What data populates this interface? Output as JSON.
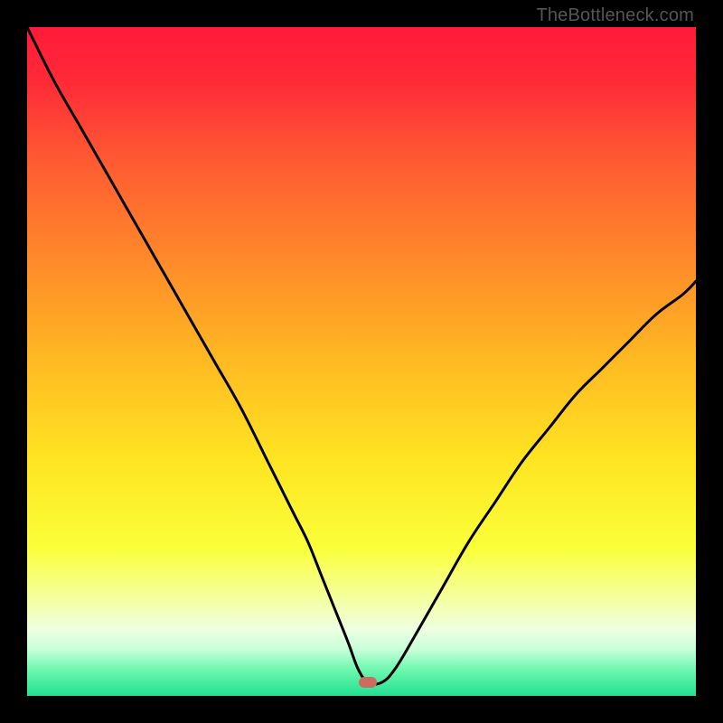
{
  "watermark": "TheBottleneck.com",
  "colors": {
    "marker": "#cf6a60",
    "curve": "#000000",
    "gradient_stops": [
      {
        "pct": 0,
        "color": "#ff1a3a"
      },
      {
        "pct": 8,
        "color": "#ff2a38"
      },
      {
        "pct": 20,
        "color": "#ff5a32"
      },
      {
        "pct": 35,
        "color": "#ff8a2a"
      },
      {
        "pct": 50,
        "color": "#ffba22"
      },
      {
        "pct": 65,
        "color": "#ffe522"
      },
      {
        "pct": 78,
        "color": "#faff3a"
      },
      {
        "pct": 86,
        "color": "#f4ffa8"
      },
      {
        "pct": 90,
        "color": "#eeffe0"
      },
      {
        "pct": 93,
        "color": "#c8ffd8"
      },
      {
        "pct": 96,
        "color": "#70f8b0"
      },
      {
        "pct": 100,
        "color": "#20e090"
      }
    ]
  },
  "chart_data": {
    "type": "line",
    "title": "",
    "xlabel": "",
    "ylabel": "",
    "xlim": [
      0,
      100
    ],
    "ylim": [
      0,
      100
    ],
    "marker": {
      "x": 51,
      "y": 2
    },
    "series": [
      {
        "name": "bottleneck-curve",
        "x": [
          0,
          4,
          8,
          12,
          16,
          20,
          24,
          28,
          32,
          36,
          38,
          40,
          42,
          44,
          46,
          48,
          49.5,
          51,
          53,
          55,
          58,
          62,
          66,
          70,
          74,
          78,
          82,
          86,
          90,
          94,
          98,
          100
        ],
        "y": [
          100,
          92,
          85,
          78,
          71,
          64,
          57,
          50,
          43,
          35,
          31,
          27,
          23,
          18,
          13,
          8,
          4,
          2,
          2,
          4,
          9,
          16,
          23,
          29,
          35,
          40,
          45,
          49,
          53,
          57,
          60,
          62
        ]
      }
    ]
  }
}
